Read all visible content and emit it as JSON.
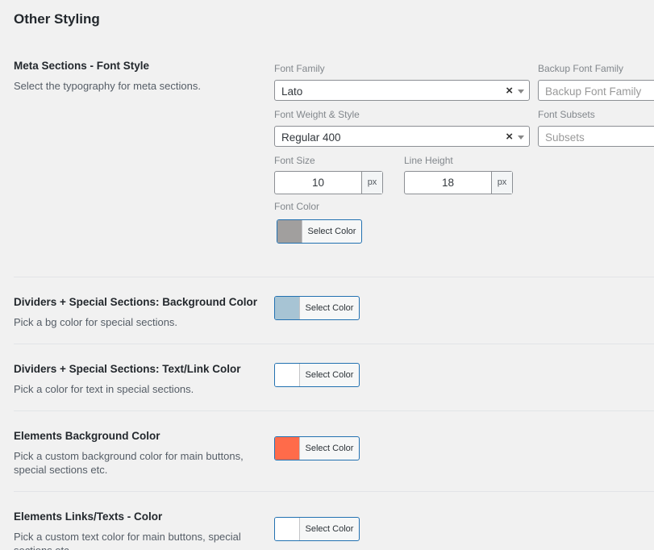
{
  "page_title": "Other Styling",
  "meta": {
    "title": "Meta Sections - Font Style",
    "desc": "Select the typography for meta sections.",
    "font_family": {
      "label": "Font Family",
      "value": "Lato"
    },
    "backup_font": {
      "label": "Backup Font Family",
      "placeholder": "Backup Font Family"
    },
    "font_weight": {
      "label": "Font Weight & Style",
      "value": "Regular 400"
    },
    "font_subsets": {
      "label": "Font Subsets",
      "placeholder": "Subsets"
    },
    "font_size": {
      "label": "Font Size",
      "value": "10",
      "unit": "px"
    },
    "line_height": {
      "label": "Line Height",
      "value": "18",
      "unit": "px"
    },
    "font_color": {
      "label": "Font Color",
      "button": "Select Color",
      "swatch": "#a19f9e"
    }
  },
  "clear_glyph": "×",
  "sections": [
    {
      "title": "Dividers + Special Sections: Background Color",
      "desc": "Pick a bg color for special sections.",
      "button": "Select Color",
      "swatch": "#a7c4d4"
    },
    {
      "title": "Dividers + Special Sections: Text/Link Color",
      "desc": "Pick a color for text in special sections.",
      "button": "Select Color",
      "swatch": "#ffffff"
    },
    {
      "title": "Elements Background Color",
      "desc": "Pick a custom background color for main buttons, special sections etc.",
      "button": "Select Color",
      "swatch": "#ff6b4a"
    },
    {
      "title": "Elements Links/Texts - Color",
      "desc": "Pick a custom text color for main buttons, special sections etc.",
      "button": "Select Color",
      "swatch": "#ffffff"
    }
  ]
}
